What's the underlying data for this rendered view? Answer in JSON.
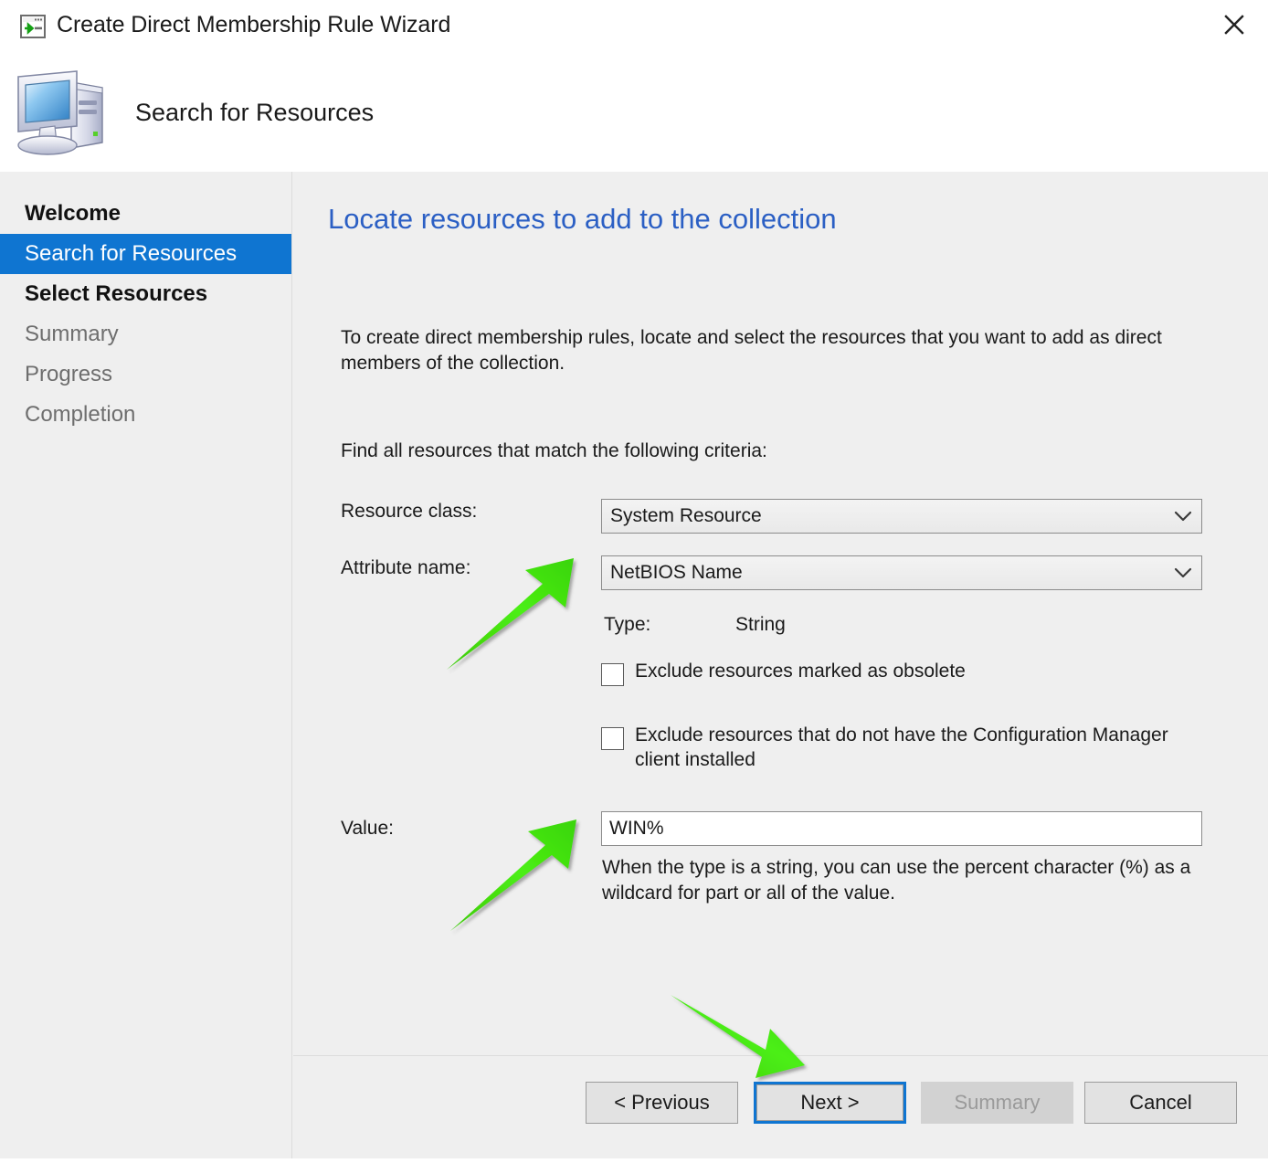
{
  "window": {
    "title": "Create Direct Membership Rule Wizard",
    "title_icon": "wizard-window-icon",
    "close_icon": "close-icon"
  },
  "header": {
    "title": "Search for Resources",
    "icon": "computer-icon"
  },
  "sidebar": {
    "items": [
      {
        "label": "Welcome",
        "state": "done"
      },
      {
        "label": "Search for Resources",
        "state": "active"
      },
      {
        "label": "Select Resources",
        "state": "done"
      },
      {
        "label": "Summary",
        "state": "pending"
      },
      {
        "label": "Progress",
        "state": "pending"
      },
      {
        "label": "Completion",
        "state": "pending"
      }
    ]
  },
  "content": {
    "heading": "Locate resources to add to the collection",
    "intro": "To create direct membership rules, locate and select the resources that you want to add as direct members of the collection.",
    "criteria_prompt": "Find all resources that match the following criteria:",
    "resource_class": {
      "label": "Resource class:",
      "value": "System Resource",
      "arrow_icon": "chevron-down-icon"
    },
    "attribute_name": {
      "label": "Attribute name:",
      "value": "NetBIOS Name",
      "arrow_icon": "chevron-down-icon"
    },
    "type": {
      "label": "Type:",
      "value": "String"
    },
    "checkbox_obsolete": {
      "label": "Exclude resources marked as obsolete",
      "checked": false
    },
    "checkbox_no_client": {
      "label": "Exclude resources that do not have the Configuration Manager client installed",
      "checked": false
    },
    "value_field": {
      "label": "Value:",
      "value": "WIN%",
      "placeholder": ""
    },
    "value_hint": "When the type is a string, you can use the percent character (%) as a wildcard for part or all of the value."
  },
  "footer": {
    "previous_label": "< Previous",
    "next_label": "Next >",
    "summary_label": "Summary",
    "cancel_label": "Cancel"
  },
  "annotations": {
    "arrow_color": "#3ddd0d",
    "arrows": [
      {
        "name": "arrow-to-attribute-name"
      },
      {
        "name": "arrow-to-value-field"
      },
      {
        "name": "arrow-to-next-button"
      }
    ]
  },
  "colors": {
    "accent_blue": "#0f75d1",
    "heading_blue": "#2b5fc4",
    "panel_gray": "#efefef",
    "arrow_green": "#3ddd0d"
  }
}
